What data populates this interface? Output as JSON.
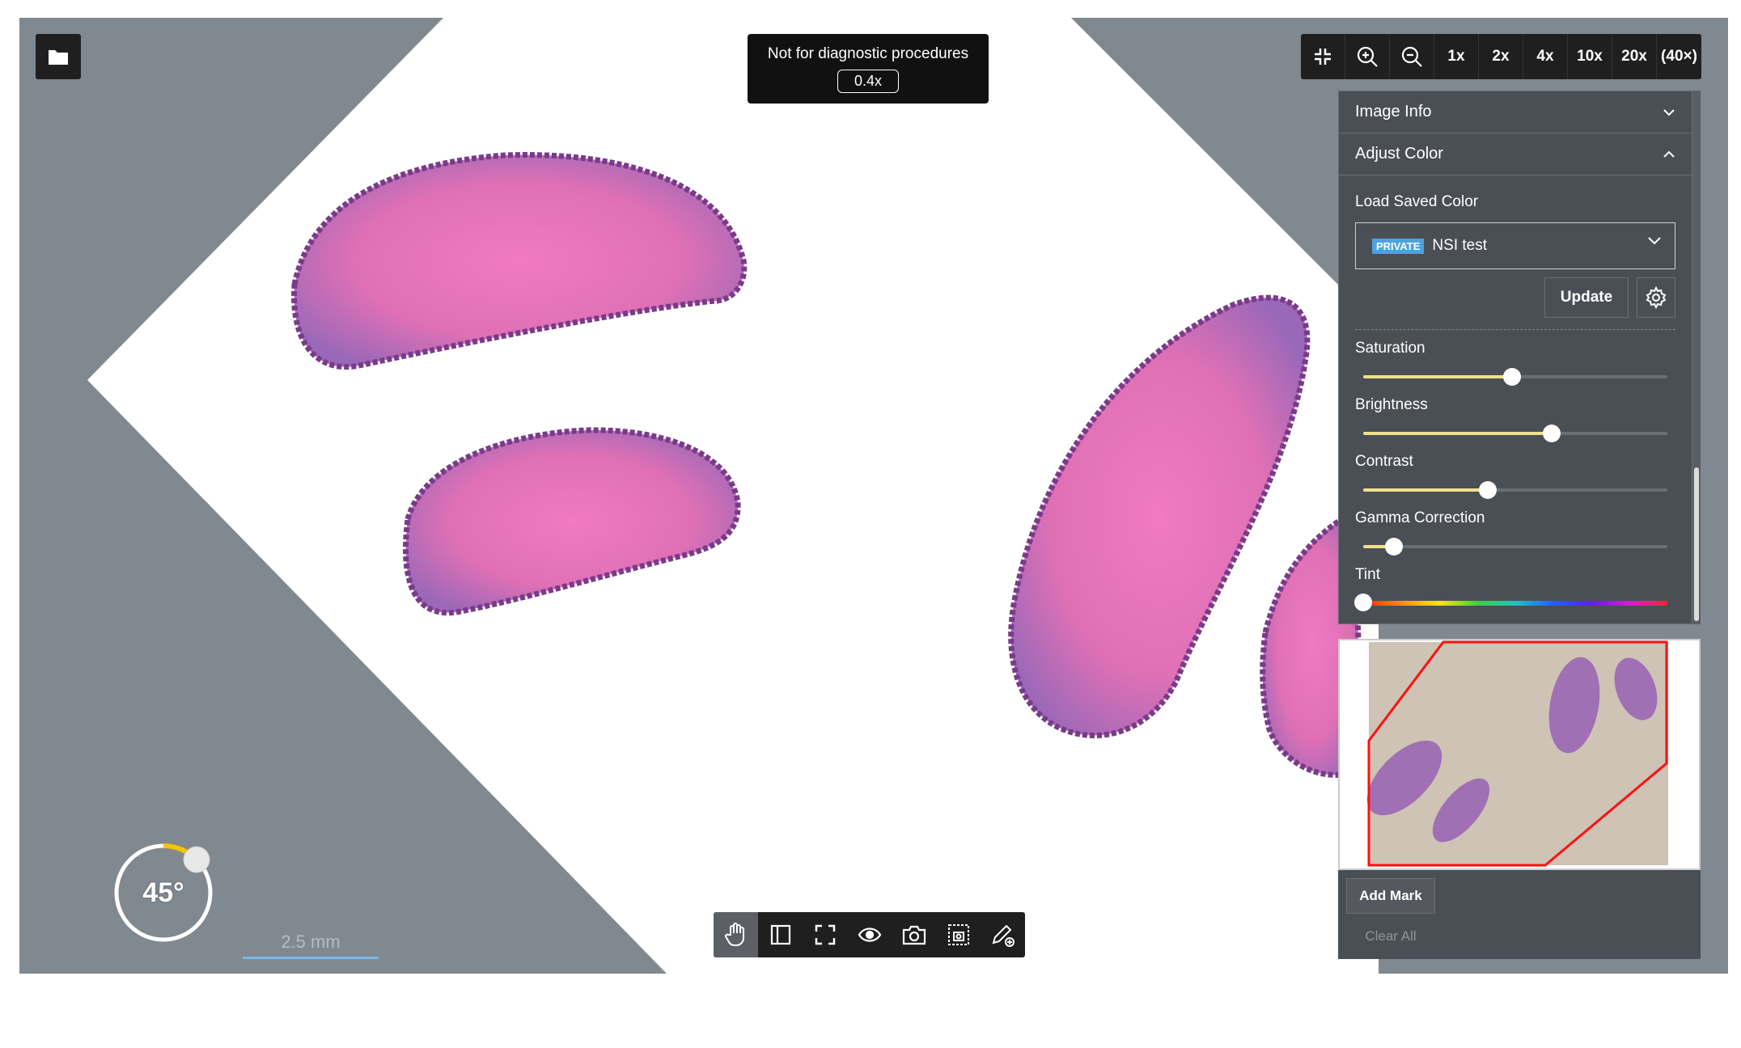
{
  "notice": {
    "message": "Not for diagnostic procedures",
    "zoom": "0.4x"
  },
  "zoom_bar": {
    "zooms": [
      "1x",
      "2x",
      "4x",
      "10x",
      "20x",
      "(40×)"
    ]
  },
  "panel": {
    "image_info": "Image Info",
    "adjust_color": "Adjust Color",
    "load_saved_color": "Load Saved Color",
    "private_badge": "PRIVATE",
    "selected_color": "NSI test",
    "update_label": "Update",
    "sliders": [
      {
        "label": "Saturation",
        "value": 0.49
      },
      {
        "label": "Brightness",
        "value": 0.62
      },
      {
        "label": "Contrast",
        "value": 0.41
      },
      {
        "label": "Gamma Correction",
        "value": 0.1
      }
    ],
    "tint": {
      "label": "Tint",
      "value": 0.0
    }
  },
  "marks": {
    "add_mark": "Add Mark",
    "clear_all": "Clear All"
  },
  "rotation": {
    "angle": "45°"
  },
  "scale_bar": {
    "label": "2.5 mm"
  },
  "colors": {
    "accent_yellow": "#f1e08a",
    "tissue": "#e47ab8",
    "panel": "#4a4f55",
    "scale": "#79b8e6"
  },
  "icons": [
    "folder-icon",
    "exit-fullscreen-icon",
    "zoom-in-icon",
    "zoom-out-icon",
    "chevron-down-icon",
    "chevron-up-icon",
    "gear-icon",
    "hand-icon",
    "panel-icon",
    "fullscreen-icon",
    "eye-icon",
    "camera-icon",
    "capture-region-icon",
    "annotate-pen-icon"
  ]
}
